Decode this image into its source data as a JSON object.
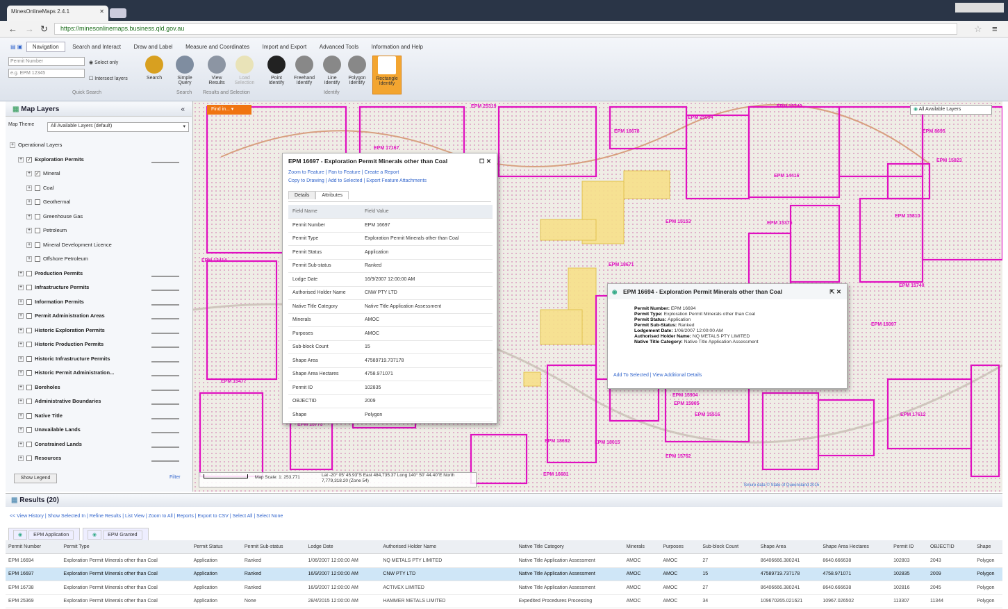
{
  "browser": {
    "tab_title": "MinesOnlineMaps 2.4.1",
    "url": "https://minesonlinemaps.business.qld.gov.au"
  },
  "ribbon": {
    "tabs": [
      "Navigation",
      "Search and Interact",
      "Draw and Label",
      "Measure and Coordinates",
      "Import and Export",
      "Advanced Tools",
      "Information and Help"
    ],
    "qs_select": "Permit Number",
    "qs_option1": "Select only",
    "qs_option2": "Intersect layers",
    "qs_input": "e.g. EPM 12345",
    "buttons": [
      {
        "label": "Search"
      },
      {
        "label": "Simple Query"
      },
      {
        "label": "View Results"
      },
      {
        "label": "Load Selection"
      },
      {
        "label": "Point Identify"
      },
      {
        "label": "Freehand Identify"
      },
      {
        "label": "Line Identify"
      },
      {
        "label": "Polygon Identify"
      },
      {
        "label": "Rectangle Identify"
      }
    ],
    "groups": [
      "Quick Search",
      "Search",
      "Results and Selection",
      "Identify"
    ]
  },
  "left": {
    "title": "Map Layers",
    "theme_label": "Map Theme",
    "theme_value": "All Available Layers (default)",
    "layers": [
      {
        "label": "Operational Layers",
        "indent": 0
      },
      {
        "label": "Exploration Permits",
        "indent": 1,
        "checked": true
      },
      {
        "label": "Mineral",
        "indent": 2,
        "checked": true
      },
      {
        "label": "Coal",
        "indent": 2
      },
      {
        "label": "Geothermal",
        "indent": 2
      },
      {
        "label": "Greenhouse Gas",
        "indent": 2
      },
      {
        "label": "Petroleum",
        "indent": 2
      },
      {
        "label": "Mineral Development Licence",
        "indent": 2
      },
      {
        "label": "Offshore Petroleum",
        "indent": 2
      },
      {
        "label": "Production Permits",
        "indent": 1
      },
      {
        "label": "Infrastructure Permits",
        "indent": 1
      },
      {
        "label": "Information Permits",
        "indent": 1
      },
      {
        "label": "Permit Administration Areas",
        "indent": 1
      },
      {
        "label": "Historic Exploration Permits",
        "indent": 1
      },
      {
        "label": "Historic Production Permits",
        "indent": 1
      },
      {
        "label": "Historic Infrastructure Permits",
        "indent": 1
      },
      {
        "label": "Historic Permit Administration...",
        "indent": 1
      },
      {
        "label": "Boreholes",
        "indent": 1
      },
      {
        "label": "Administrative Boundaries",
        "indent": 1
      },
      {
        "label": "Native Title",
        "indent": 1
      },
      {
        "label": "Unavailable Lands",
        "indent": 1
      },
      {
        "label": "Constrained Lands",
        "indent": 1
      },
      {
        "label": "Resources",
        "indent": 1
      }
    ],
    "show_legend": "Show Legend",
    "filter": "Filter"
  },
  "map": {
    "find_button": "Find in...",
    "layer_select": "All Available Layers",
    "scale_text": "Map Scale: 1:  253,771",
    "coords": "Lat   -20° 05' 45.93\"S   East   484,735.37   Long   140° 50' 44.40\"E   North   7,779,318.20 (Zone 54)",
    "attribution": "Tenure data © State of Queensland 2015",
    "labels": [
      "EPM 25319",
      "EPM 15749",
      "EPM 25094",
      "EPM 16678",
      "EPM 8695",
      "EPM 15823",
      "EPM 14416",
      "EPM 14414",
      "EPM 15810",
      "EPM 15153",
      "EPM 15375",
      "EPM 18671",
      "EPM 15740",
      "EPM 15097",
      "EPM 15477",
      "EPM 15904",
      "EPM 15905",
      "EPM 15516",
      "EPM 17612",
      "EPM 15773",
      "EPM 18015",
      "EPM 15762",
      "EPM 16681",
      "EPM 18692",
      "EPM 13414",
      "EPM 17167"
    ]
  },
  "popup1": {
    "title": "EPM 16697 - Exploration Permit Minerals other than Coal",
    "links1": "Zoom to Feature  |  Pan to Feature  |  Create a Report",
    "links2": "Copy to Drawing  |  Add to Selected  |  Export Feature Attachments",
    "tab_details": "Details",
    "tab_attributes": "Attributes",
    "rows": [
      [
        "Field Name",
        "Field Value"
      ],
      [
        "Permit Number",
        "EPM 16697"
      ],
      [
        "Permit Type",
        "Exploration Permit Minerals other than Coal"
      ],
      [
        "Permit Status",
        "Application"
      ],
      [
        "Permit Sub-status",
        "Ranked"
      ],
      [
        "Lodge Date",
        "16/9/2007 12:00:00 AM"
      ],
      [
        "Authorised Holder Name",
        "CNW PTY LTD"
      ],
      [
        "Native Title Category",
        "Native Title Application Assessment"
      ],
      [
        "Minerals",
        "AMOC"
      ],
      [
        "Purposes",
        "AMOC"
      ],
      [
        "Sub-block Count",
        "15"
      ],
      [
        "Shape Area",
        "47589719.737178"
      ],
      [
        "Shape Area Hectares",
        "4758.971071"
      ],
      [
        "Permit ID",
        "102835"
      ],
      [
        "OBJECTID",
        "2009"
      ],
      [
        "Shape",
        "Polygon"
      ]
    ]
  },
  "popup2": {
    "title": "EPM 16694 - Exploration Permit Minerals other than Coal",
    "fields": [
      [
        "Permit Number:",
        "EPM 16694"
      ],
      [
        "Permit Type:",
        "Exploration Permit Minerals other than Coal"
      ],
      [
        "Permit Status:",
        "Application"
      ],
      [
        "Permit Sub-Status:",
        "Ranked"
      ],
      [
        "Lodgement Date:",
        "1/06/2007 12:00:00 AM"
      ],
      [
        "Authorised Holder Name:",
        "NQ METALS PTY LIMITED"
      ],
      [
        "Native Title Category:",
        "Native Title Application Assessment"
      ]
    ],
    "links": "Add To Selected   |   View Additional Details"
  },
  "results": {
    "title": "Results (20)",
    "tools": "<< View History  |  Show Selected In  |  Refine Results  |  List View  |  Zoom to All  |  Reports  |  Export to CSV  |  Select All  |  Select None",
    "tabs": [
      "EPM Application",
      "EPM Granted"
    ],
    "headers": [
      "Permit Number",
      "Permit Type",
      "Permit Status",
      "Permit Sub-status",
      "Lodge Date",
      "Authorised Holder Name",
      "Native Title Category",
      "Minerals",
      "Purposes",
      "Sub-block Count",
      "Shape Area",
      "Shape Area Hectares",
      "Permit ID",
      "OBJECTID",
      "Shape"
    ],
    "rows": [
      [
        "EPM 16694",
        "Exploration Permit Minerals other than Coal",
        "Application",
        "Ranked",
        "1/06/2007 12:00:00 AM",
        "NQ METALS PTY LIMITED",
        "Native Title Application Assessment",
        "AMOC",
        "AMOC",
        "27",
        "86406666.380241",
        "8640.666638",
        "102803",
        "2043",
        "Polygon"
      ],
      [
        "EPM 16697",
        "Exploration Permit Minerals other than Coal",
        "Application",
        "Ranked",
        "16/9/2007 12:00:00 AM",
        "CNW PTY LTD",
        "Native Title Application Assessment",
        "AMOC",
        "AMOC",
        "15",
        "47589719.737178",
        "4758.971071",
        "102835",
        "2009",
        "Polygon"
      ],
      [
        "EPM 16738",
        "Exploration Permit Minerals other than Coal",
        "Application",
        "Ranked",
        "16/9/2007 12:00:00 AM",
        "ACTIVEX LIMITED",
        "Native Title Application Assessment",
        "AMOC",
        "AMOC",
        "27",
        "86406666.380241",
        "8640.666638",
        "102816",
        "2045",
        "Polygon"
      ],
      [
        "EPM 25369",
        "Exploration Permit Minerals other than Coal",
        "Application",
        "None",
        "28/4/2015 12:00:00 AM",
        "HAMMER METALS LIMITED",
        "Expedited Procedures Processing",
        "AMOC",
        "AMOC",
        "34",
        "109670265.021621",
        "10967.026502",
        "113307",
        "11344",
        "Polygon"
      ]
    ]
  },
  "colors": {
    "accent": "#f07410",
    "permit": "#e010c0",
    "selection": "#f7e08a"
  }
}
